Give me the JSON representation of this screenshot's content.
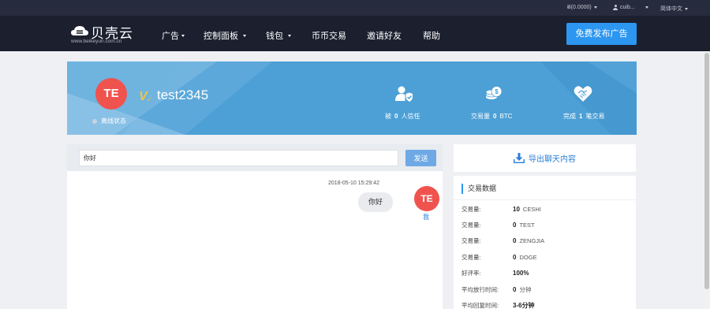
{
  "topbar": {
    "balance": "Ƀ(0.0000)",
    "user": "cuib...",
    "language": "简体中文"
  },
  "nav": {
    "logo_text": "贝壳云",
    "logo_url": "www.beikeyun.com.cn",
    "items": [
      {
        "label": "广告",
        "dropdown": true
      },
      {
        "label": "控制面板",
        "dropdown": true
      },
      {
        "label": "钱包",
        "dropdown": true
      },
      {
        "label": "币币交易",
        "dropdown": false
      },
      {
        "label": "邀请好友",
        "dropdown": false
      },
      {
        "label": "帮助",
        "dropdown": false
      }
    ],
    "publish_button": "免费发布广告"
  },
  "profile": {
    "avatar_initials": "TE",
    "verified_mark": "V",
    "username": "test2345",
    "status": "离线状态",
    "stats": {
      "trust_prefix": "被",
      "trust_value": "0",
      "trust_suffix": "人信任",
      "volume_prefix": "交易量",
      "volume_value": "0",
      "volume_suffix": "BTC",
      "completed_prefix": "完成",
      "completed_value": "1",
      "completed_suffix": "笔交易"
    }
  },
  "chat": {
    "input_value": "你好",
    "send_button": "发送",
    "messages": [
      {
        "time": "2018-05-10 15:29:42",
        "text": "你好",
        "avatar": "TE",
        "sender": "我"
      }
    ]
  },
  "export": {
    "label": "导出聊天内容"
  },
  "trade_data": {
    "title": "交易数据",
    "rows": [
      {
        "key": "交易量:",
        "value": "10",
        "unit": "CESHI"
      },
      {
        "key": "交易量:",
        "value": "0",
        "unit": "TEST"
      },
      {
        "key": "交易量:",
        "value": "0",
        "unit": "ZENGJIA"
      },
      {
        "key": "交易量:",
        "value": "0",
        "unit": "DOGE"
      },
      {
        "key": "好评率:",
        "value": "100%",
        "unit": ""
      },
      {
        "key": "平均放行时间:",
        "value": "0",
        "unit": "分钟"
      },
      {
        "key": "平均回复时间:",
        "value": "3-6分钟",
        "unit": ""
      }
    ]
  },
  "colors": {
    "nav_bg": "#1b1f2e",
    "topbar_bg": "#262b3d",
    "accent": "#2c96f0",
    "banner": "#4da0d6",
    "avatar": "#f0534e",
    "link": "#2c7fd6"
  }
}
